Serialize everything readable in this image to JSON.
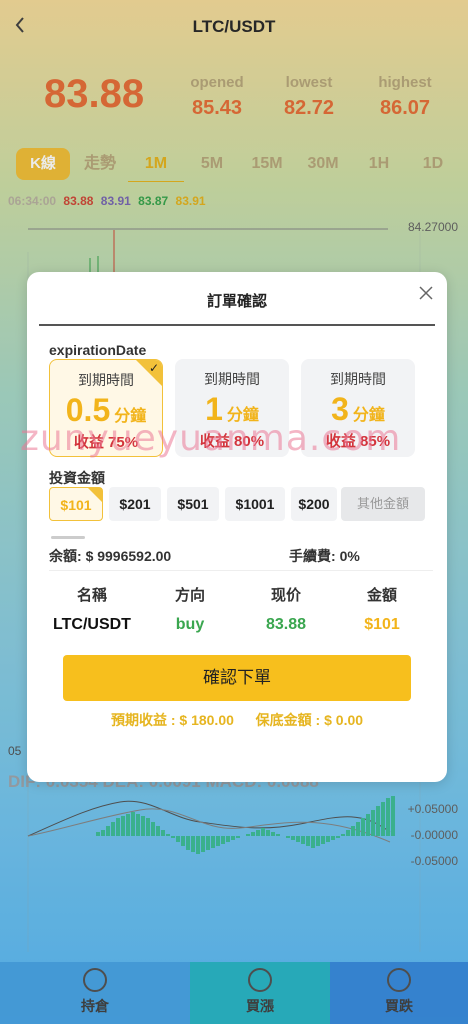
{
  "header": {
    "title": "LTC/USDT",
    "back_icon": "chevron-left-icon"
  },
  "ticker": {
    "last_price": "83.88",
    "opened_label": "opened",
    "opened_value": "85.43",
    "lowest_label": "lowest",
    "lowest_value": "82.72",
    "highest_label": "highest",
    "highest_value": "86.07"
  },
  "periods": {
    "kline": "K線",
    "trend": "走勢",
    "m1": "1M",
    "m5": "5M",
    "m15": "15M",
    "m30": "30M",
    "h1": "1H",
    "d1": "1D"
  },
  "ohlc": {
    "time": "06:34:00",
    "o": "83.88",
    "h": "83.91",
    "l": "83.87",
    "c": "83.91"
  },
  "chart": {
    "top_label": "84.27000",
    "macd_labels": [
      "+0.05000",
      "-0.00000",
      "-0.05000"
    ],
    "indicator_prefix": "DIF: 0.0354 DEA: 0.0091 MACD: 0.0088",
    "left_time": "05"
  },
  "tabbar": {
    "hold": "持倉",
    "buy_up": "買漲",
    "buy_down": "買跌"
  },
  "modal": {
    "title": "訂單確認",
    "expiration_label": "expirationDate",
    "cards": [
      {
        "header": "到期時間",
        "num": "0.5",
        "unit": "分鐘",
        "yield": "收益 75%"
      },
      {
        "header": "到期時間",
        "num": "1",
        "unit": "分鐘",
        "yield": "收益 80%"
      },
      {
        "header": "到期時間",
        "num": "3",
        "unit": "分鐘",
        "yield": "收益 85%"
      }
    ],
    "amount_label": "投資金額",
    "amounts": [
      "$101",
      "$201",
      "$501",
      "$1001",
      "$200",
      "其他金額"
    ],
    "balance_label": "余額:",
    "balance_value": "$ 9996592.00",
    "fee_label": "手續費:",
    "fee_value": "0%",
    "table_headers": [
      "名稱",
      "方向",
      "现价",
      "金額"
    ],
    "table_values": [
      "LTC/USDT",
      "buy",
      "83.88",
      "$101"
    ],
    "confirm_label": "確認下單",
    "expected_label": "預期收益 : $ 180.00",
    "margin_label": "保底金額 : $ 0.00"
  },
  "watermark": "zunyueyuanma.com",
  "colors": {
    "accent": "#f2c13a",
    "up": "#3aa64f",
    "price": "#e8703a",
    "yield": "#d3343c"
  }
}
